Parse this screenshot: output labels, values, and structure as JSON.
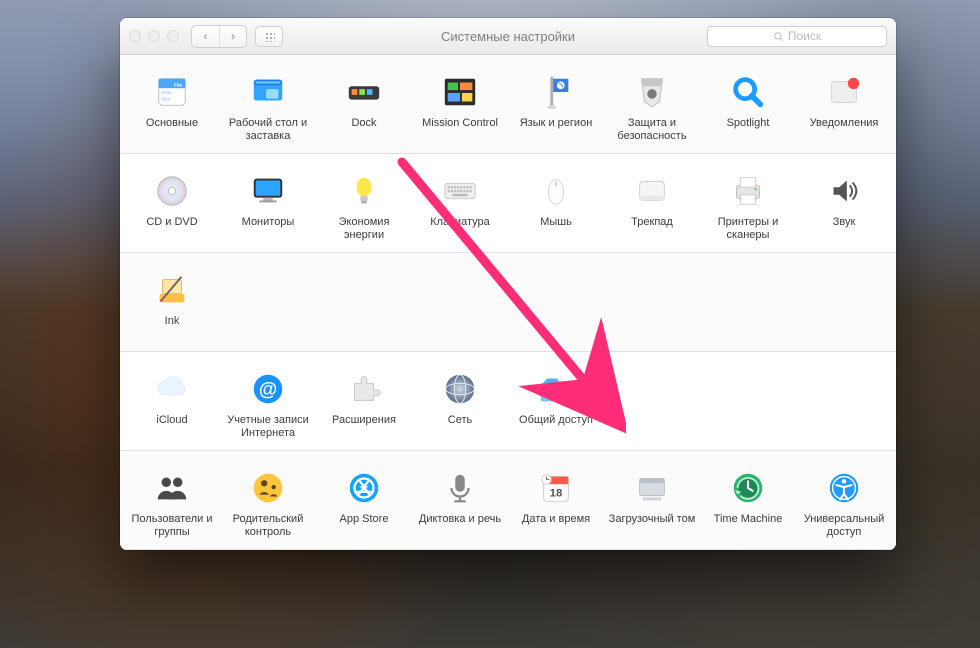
{
  "window": {
    "title": "Системные настройки",
    "search_placeholder": "Поиск"
  },
  "rows": [
    [
      {
        "key": "general",
        "label": "Основные"
      },
      {
        "key": "desktop",
        "label": "Рабочий стол и заставка"
      },
      {
        "key": "dock",
        "label": "Dock"
      },
      {
        "key": "mission",
        "label": "Mission Control"
      },
      {
        "key": "language",
        "label": "Язык и регион"
      },
      {
        "key": "security",
        "label": "Защита и безопасность"
      },
      {
        "key": "spotlight",
        "label": "Spotlight"
      },
      {
        "key": "notifications",
        "label": "Уведомления"
      }
    ],
    [
      {
        "key": "cddvd",
        "label": "CD и DVD"
      },
      {
        "key": "displays",
        "label": "Мониторы"
      },
      {
        "key": "energy",
        "label": "Экономия энергии"
      },
      {
        "key": "keyboard",
        "label": "Клавиатура"
      },
      {
        "key": "mouse",
        "label": "Мышь"
      },
      {
        "key": "trackpad",
        "label": "Трекпад"
      },
      {
        "key": "printers",
        "label": "Принтеры и сканеры"
      },
      {
        "key": "sound",
        "label": "Звук"
      }
    ],
    [
      {
        "key": "ink",
        "label": "Ink"
      }
    ],
    [
      {
        "key": "icloud",
        "label": "iCloud"
      },
      {
        "key": "accounts",
        "label": "Учетные записи Интернета"
      },
      {
        "key": "extensions",
        "label": "Расширения"
      },
      {
        "key": "network",
        "label": "Сеть"
      },
      {
        "key": "sharing",
        "label": "Общий доступ"
      }
    ],
    [
      {
        "key": "users",
        "label": "Пользователи и группы"
      },
      {
        "key": "parental",
        "label": "Родительский контроль"
      },
      {
        "key": "appstore",
        "label": "App Store"
      },
      {
        "key": "dictation",
        "label": "Диктовка и речь"
      },
      {
        "key": "datetime",
        "label": "Дата и время"
      },
      {
        "key": "startup",
        "label": "Загрузочный том"
      },
      {
        "key": "timemachine",
        "label": "Time Machine"
      },
      {
        "key": "accessibility",
        "label": "Универсальный доступ"
      }
    ]
  ]
}
